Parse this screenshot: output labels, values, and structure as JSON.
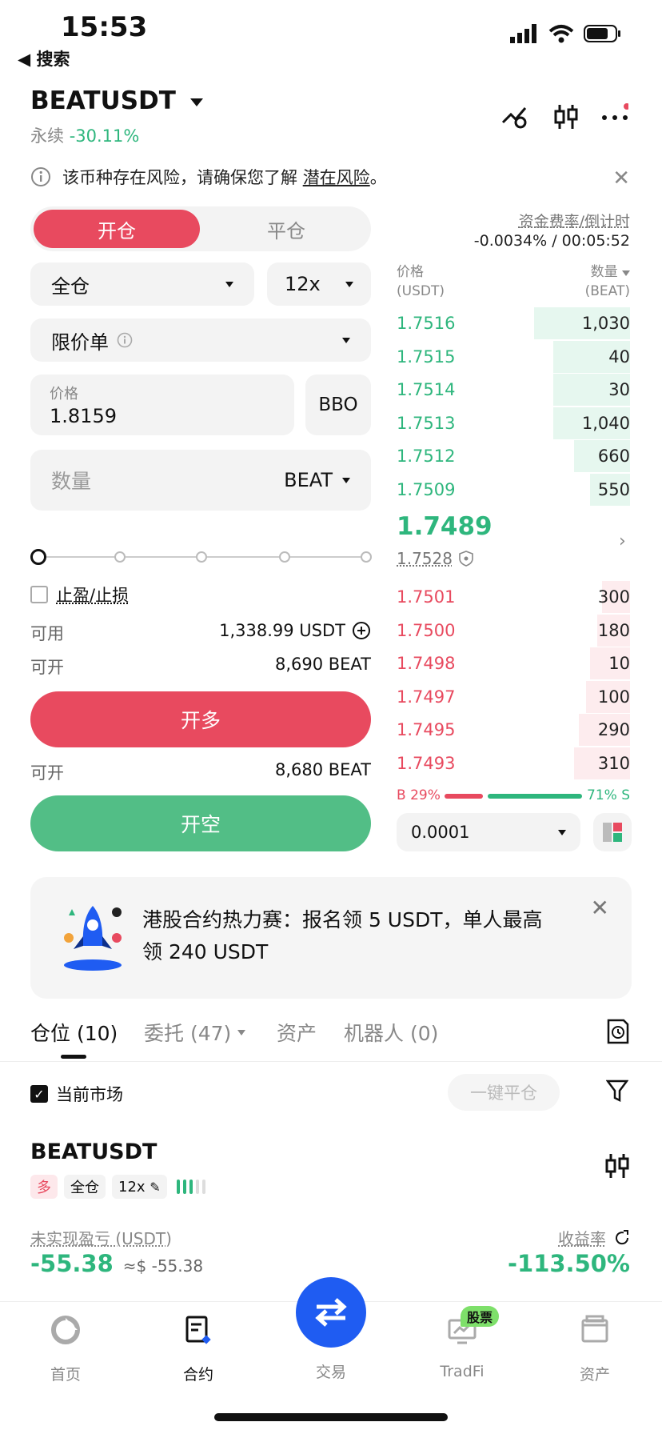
{
  "status": {
    "time": "15:53",
    "back_label": "◀ 搜索"
  },
  "header": {
    "symbol": "BEATUSDT",
    "type": "永续",
    "change": "-30.11%"
  },
  "notice": {
    "text": "该币种存在风险，请确保您了解",
    "link": "潜在风险",
    "end": "。"
  },
  "order_form": {
    "tab_open": "开仓",
    "tab_close": "平仓",
    "margin_mode": "全仓",
    "leverage": "12x",
    "order_type": "限价单",
    "price_label": "价格",
    "price_value": "1.8159",
    "bbo": "BBO",
    "qty_placeholder": "数量",
    "qty_unit": "BEAT",
    "tpsl": "止盈/止损",
    "available_label": "可用",
    "available_value": "1,338.99 USDT",
    "can_open_label": "可开",
    "can_open_long": "8,690 BEAT",
    "long_button": "开多",
    "can_open_short": "8,680 BEAT",
    "short_button": "开空",
    "slider_percent": 0
  },
  "funding": {
    "label": "资金费率/倒计时",
    "value": "-0.0034% / 00:05:52"
  },
  "orderbook": {
    "price_header": "价格",
    "price_unit": "(USDT)",
    "qty_header": "数量",
    "qty_unit": "(BEAT)",
    "asks": [
      {
        "price": "1.7516",
        "qty": "1,030",
        "depth": 0.41
      },
      {
        "price": "1.7515",
        "qty": "40",
        "depth": 0.33
      },
      {
        "price": "1.7514",
        "qty": "30",
        "depth": 0.33
      },
      {
        "price": "1.7513",
        "qty": "1,040",
        "depth": 0.33
      },
      {
        "price": "1.7512",
        "qty": "660",
        "depth": 0.24
      },
      {
        "price": "1.7509",
        "qty": "550",
        "depth": 0.17
      }
    ],
    "last_price": "1.7489",
    "mark_price": "1.7528",
    "bids": [
      {
        "price": "1.7501",
        "qty": "300",
        "depth": 0.12
      },
      {
        "price": "1.7500",
        "qty": "180",
        "depth": 0.14
      },
      {
        "price": "1.7498",
        "qty": "10",
        "depth": 0.17
      },
      {
        "price": "1.7497",
        "qty": "100",
        "depth": 0.19
      },
      {
        "price": "1.7495",
        "qty": "290",
        "depth": 0.22
      },
      {
        "price": "1.7493",
        "qty": "310",
        "depth": 0.24
      }
    ],
    "buy_ratio": "B 29%",
    "sell_ratio": "71% S",
    "buy_fraction": 0.29,
    "precision": "0.0001"
  },
  "promo": {
    "line1": "港股合约热力赛：报名领 5 USDT，单人最高",
    "line2": "领 240 USDT"
  },
  "positions": {
    "tabs": [
      "仓位 (10)",
      "委托 (47)",
      "资产",
      "机器人 (0)"
    ],
    "current_market": "当前市场",
    "close_all": "一键平仓",
    "symbol": "BEATUSDT",
    "tags": [
      "多",
      "全仓",
      "12x"
    ],
    "pnl_label": "未实现盈亏 (USDT)",
    "pnl_value": "-55.38",
    "pnl_approx": "≈$ -55.38",
    "roe_label": "收益率",
    "roe_value": "-113.50%"
  },
  "nav": {
    "home": "首页",
    "contract": "合约",
    "trade": "交易",
    "tradfi": "TradFi",
    "tradfi_badge": "股票",
    "assets": "资产"
  },
  "colors": {
    "red": "#e84a5f",
    "green": "#2eb67d",
    "blue": "#1f5cf2"
  }
}
